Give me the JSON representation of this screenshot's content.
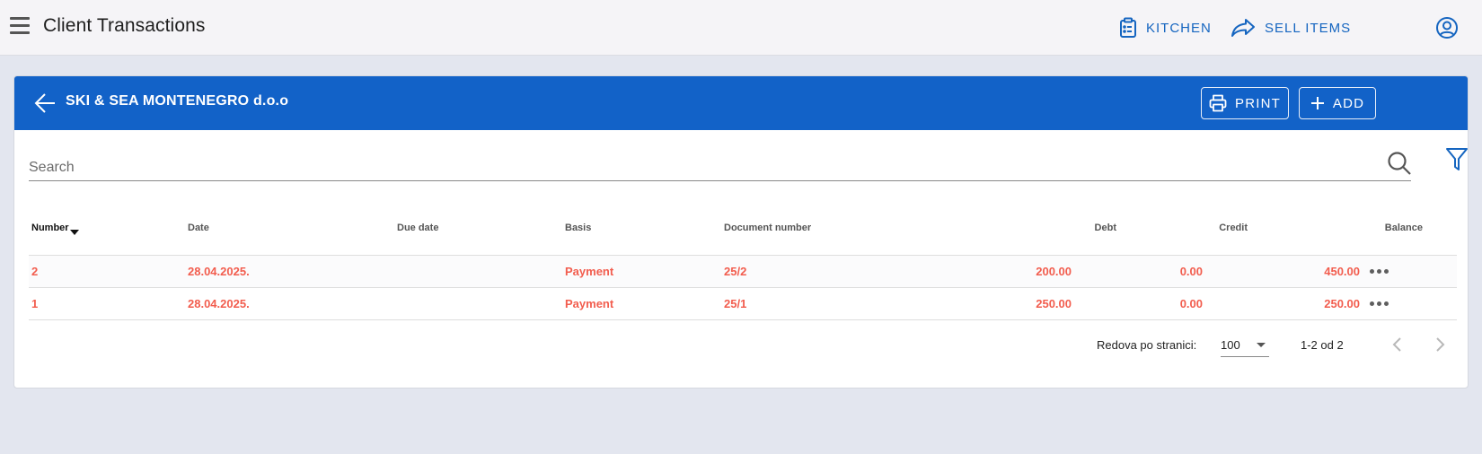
{
  "header": {
    "title": "Client Transactions",
    "kitchen_label": "KITCHEN",
    "sell_items_label": "SELL ITEMS"
  },
  "client": {
    "name": "SKI & SEA MONTENEGRO d.o.o",
    "print_label": "PRINT",
    "add_label": "ADD"
  },
  "search": {
    "placeholder": "Search"
  },
  "table": {
    "columns": {
      "number": "Number",
      "date": "Date",
      "due_date": "Due date",
      "basis": "Basis",
      "document_number": "Document number",
      "debt": "Debt",
      "credit": "Credit",
      "balance": "Balance"
    },
    "sort": {
      "column": "Number",
      "direction": "descending"
    },
    "rows": [
      {
        "number": "2",
        "date": "28.04.2025.",
        "due_date": "",
        "basis": "Payment",
        "document_number": "25/2",
        "debt": "200.00",
        "credit": "0.00",
        "balance": "450.00"
      },
      {
        "number": "1",
        "date": "28.04.2025.",
        "due_date": "",
        "basis": "Payment",
        "document_number": "25/1",
        "debt": "250.00",
        "credit": "0.00",
        "balance": "250.00"
      }
    ]
  },
  "pagination": {
    "rows_per_page_label": "Redova po stranici:",
    "rows_per_page": "100",
    "range": "1-2 od 2"
  },
  "colors": {
    "primary": "#1262c8",
    "accent_text": "#1565c0",
    "negative_row_text": "#f25d4e",
    "background": "#e3e6ef"
  },
  "icons": [
    "menu-icon",
    "clipboard-icon",
    "share-icon",
    "account-circle-icon",
    "arrow-left-icon",
    "printer-icon",
    "plus-icon",
    "search-icon",
    "filter-icon",
    "more-horizontal-icon",
    "chevron-left-icon",
    "chevron-right-icon"
  ]
}
